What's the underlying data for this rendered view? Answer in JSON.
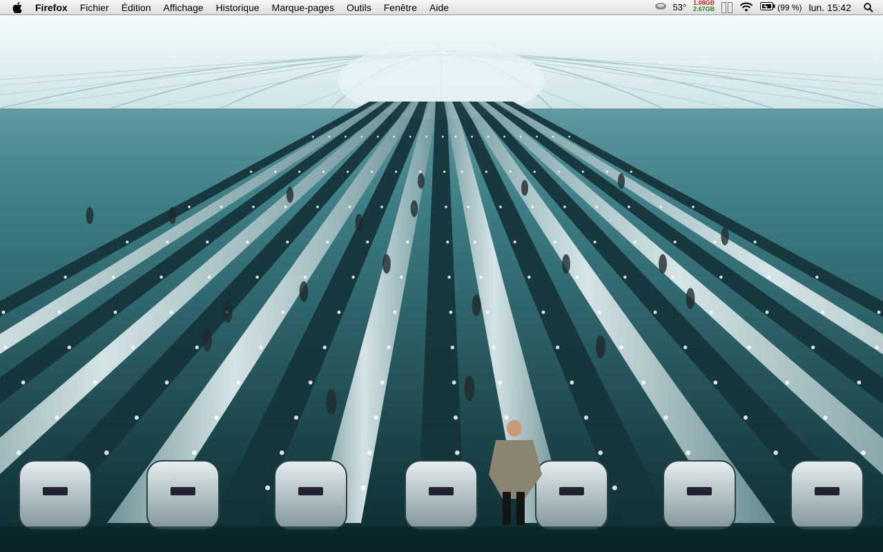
{
  "menubar": {
    "app_name": "Firefox",
    "menus": [
      "Fichier",
      "Édition",
      "Affichage",
      "Historique",
      "Marque-pages",
      "Outils",
      "Fenêtre",
      "Aide"
    ],
    "status": {
      "temperature": "53°",
      "memory_used": "1.08GB",
      "memory_free": "2.67GB",
      "battery_percent": "(99 %)",
      "clock": "lun. 15:42"
    }
  },
  "wallpaper": {
    "subject": "escalators-hall",
    "colors": {
      "steel": "#cfe0e2",
      "teal": "#3e7e86",
      "dark": "#0b2a2e",
      "light": "#ffffff"
    }
  }
}
